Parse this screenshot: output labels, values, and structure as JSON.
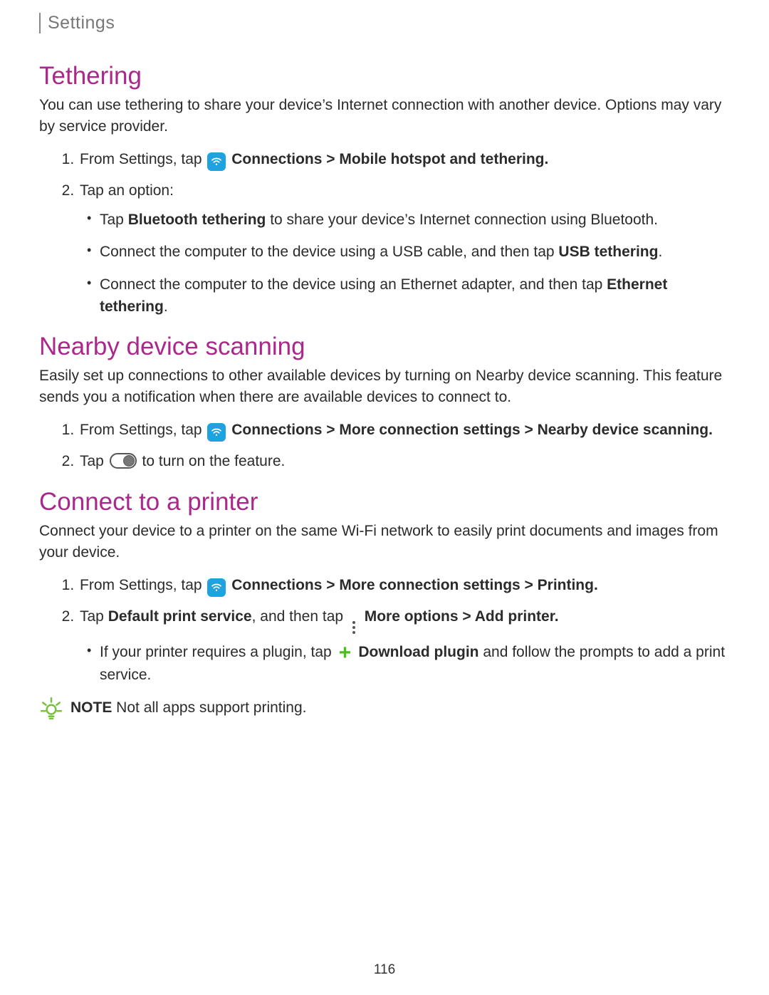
{
  "header": {
    "breadcrumb": "Settings"
  },
  "sections": {
    "tethering": {
      "title": "Tethering",
      "intro": "You can use tethering to share your device’s Internet connection with another device. Options may vary by service provider.",
      "step1_pre": "From Settings, tap ",
      "step1_path": " Connections > Mobile hotspot and tethering.",
      "step2": "Tap an option:",
      "opt_bt_pre": "Tap ",
      "opt_bt_bold": "Bluetooth tethering",
      "opt_bt_post": " to share your device’s Internet connection using Bluetooth.",
      "opt_usb_pre": "Connect the computer to the device using a USB cable, and then tap ",
      "opt_usb_bold": "USB tethering",
      "opt_usb_post": ".",
      "opt_eth_pre": "Connect the computer to the device using an Ethernet adapter, and then tap ",
      "opt_eth_bold": "Ethernet tethering",
      "opt_eth_post": "."
    },
    "nearby": {
      "title": "Nearby device scanning",
      "intro": "Easily set up connections to other available devices by turning on Nearby device scanning. This feature sends you a notification when there are available devices to connect to.",
      "step1_pre": "From Settings, tap ",
      "step1_path": " Connections > More connection settings > Nearby device scanning.",
      "step2_pre": "Tap ",
      "step2_post": " to turn on the feature."
    },
    "printer": {
      "title": "Connect to a printer",
      "intro": "Connect your device to a printer on the same Wi-Fi network to easily print documents and images from your device.",
      "step1_pre": "From Settings, tap ",
      "step1_path": " Connections > More connection settings > Printing.",
      "step2_pre": "Tap ",
      "step2_b1": "Default print service",
      "step2_mid": ", and then tap ",
      "step2_b2": " More options > Add printer.",
      "sub_pre": "If your printer requires a plugin, tap ",
      "sub_bold": " Download plugin",
      "sub_post": " and follow the prompts to add a print service.",
      "note_label": "NOTE",
      "note_text": "  Not all apps support printing."
    }
  },
  "page_number": "116"
}
